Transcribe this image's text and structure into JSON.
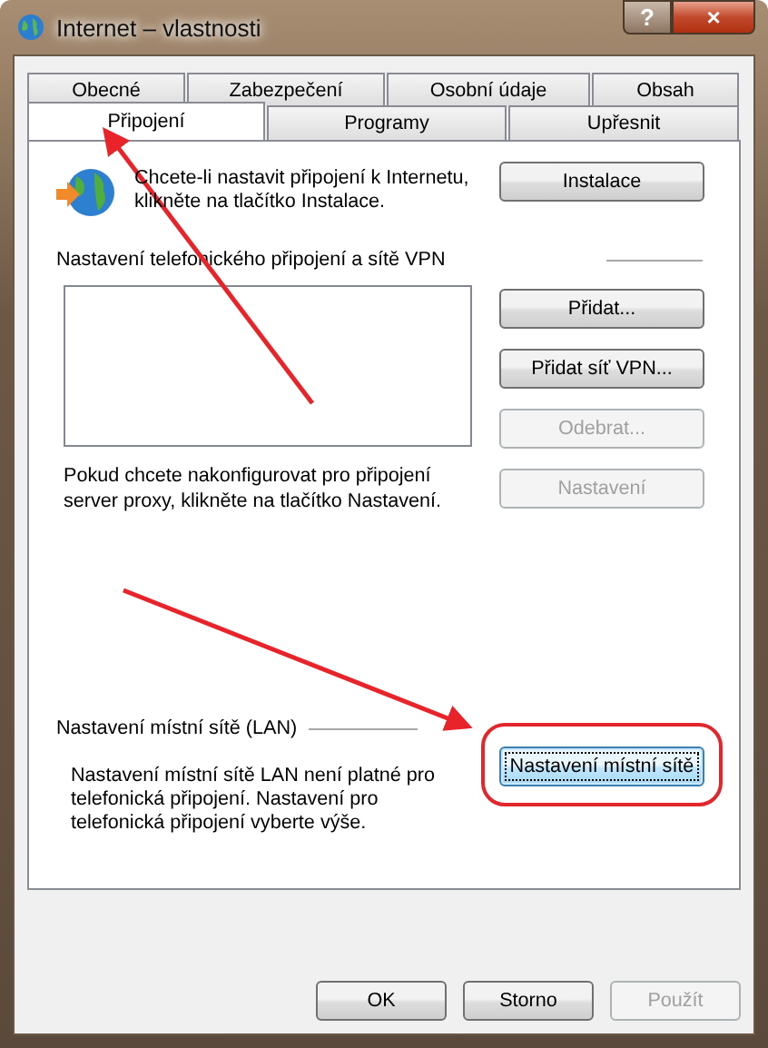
{
  "window": {
    "title": "Internet – vlastnosti",
    "help_button": "?",
    "close_button": "×"
  },
  "tab_rows": [
    [
      {
        "label": "Obecné",
        "selected": false
      },
      {
        "label": "Zabezpečení",
        "selected": false
      },
      {
        "label": "Osobní údaje",
        "selected": false
      },
      {
        "label": "Obsah",
        "selected": false
      }
    ],
    [
      {
        "label": "Připojení",
        "selected": true
      },
      {
        "label": "Programy",
        "selected": false
      },
      {
        "label": "Upřesnit",
        "selected": false
      }
    ]
  ],
  "setup": {
    "text": "Chcete-li nastavit připojení k Internetu, klikněte na tlačítko Instalace.",
    "button": "Instalace"
  },
  "vpn": {
    "heading": "Nastavení telefonického připojení a sítě VPN",
    "buttons": [
      {
        "label": "Přidat...",
        "disabled": false
      },
      {
        "label": "Přidat síť VPN...",
        "disabled": false
      },
      {
        "label": "Odebrat...",
        "disabled": true
      },
      {
        "label": "Nastavení",
        "disabled": true
      }
    ],
    "proxy_text": "Pokud chcete nakonfigurovat pro připojení server proxy, klikněte na tlačítko Nastavení."
  },
  "lan": {
    "heading": "Nastavení místní sítě (LAN)",
    "text": "Nastavení místní sítě LAN není platné pro telefonická připojení. Nastavení pro telefonická připojení vyberte výše.",
    "button": {
      "label": "Nastavení místní sítě",
      "focused": true
    }
  },
  "footer_buttons": [
    {
      "label": "OK",
      "disabled": false
    },
    {
      "label": "Storno",
      "disabled": false
    },
    {
      "label": "Použít",
      "disabled": true
    }
  ]
}
